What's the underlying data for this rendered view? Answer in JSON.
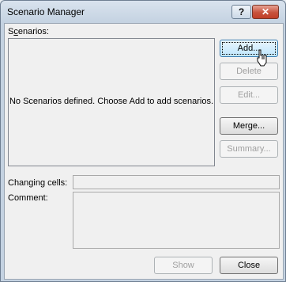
{
  "window": {
    "title": "Scenario Manager",
    "help_label": "?",
    "close_glyph": "✕"
  },
  "scenarios": {
    "label": "Scenarios:",
    "label_access_key": "c",
    "empty_message": "No Scenarios defined. Choose Add to add scenarios."
  },
  "buttons": {
    "add": "Add...",
    "delete": "Delete",
    "edit": "Edit...",
    "merge": "Merge...",
    "summary": "Summary...",
    "show": "Show",
    "close": "Close"
  },
  "fields": {
    "changing_cells_label": "Changing cells:",
    "changing_cells_value": "",
    "comment_label": "Comment:",
    "comment_value": ""
  },
  "icons": {
    "pointer": "mouse-pointer-icon"
  }
}
